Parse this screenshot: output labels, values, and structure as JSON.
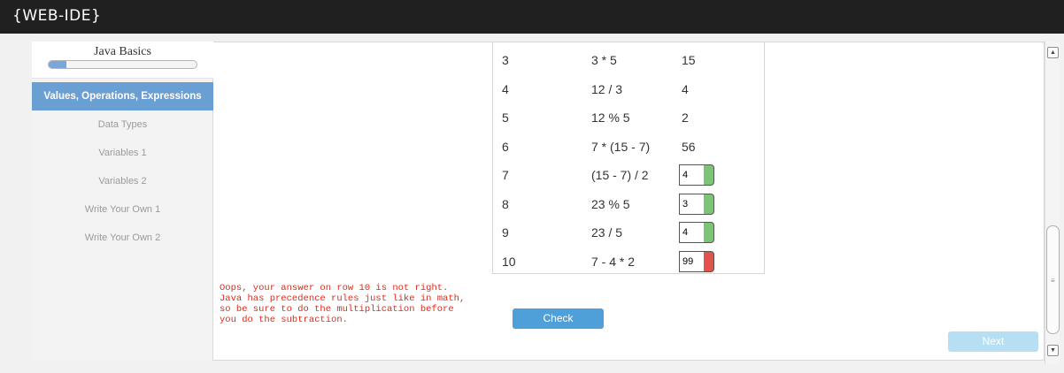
{
  "app": {
    "logo": "{WEB-IDE}"
  },
  "sidebar": {
    "title": "Java Basics",
    "progress": 0.12,
    "items": [
      {
        "label": "Values, Operations, Expressions",
        "active": true
      },
      {
        "label": "Data Types",
        "active": false
      },
      {
        "label": "Variables 1",
        "active": false
      },
      {
        "label": "Variables 2",
        "active": false
      },
      {
        "label": "Write Your Own 1",
        "active": false
      },
      {
        "label": "Write Your Own 2",
        "active": false
      }
    ]
  },
  "table": {
    "rows": [
      {
        "num": "3",
        "expr": "3 * 5",
        "result": "15"
      },
      {
        "num": "4",
        "expr": "12 / 3",
        "result": "4"
      },
      {
        "num": "5",
        "expr": "12 % 5",
        "result": "2"
      },
      {
        "num": "6",
        "expr": "7 * (15 - 7)",
        "result": "56"
      },
      {
        "num": "7",
        "expr": "(15 - 7) / 2",
        "answer": "4",
        "status": "correct"
      },
      {
        "num": "8",
        "expr": "23 % 5",
        "answer": "3",
        "status": "correct"
      },
      {
        "num": "9",
        "expr": "23 / 5",
        "answer": "4",
        "status": "correct"
      },
      {
        "num": "10",
        "expr": "7 - 4 * 2",
        "answer": "99",
        "status": "wrong"
      }
    ]
  },
  "feedback": "Oops, your answer on row 10 is not right.\nJava has precedence rules just like in math,\nso be sure to do the multiplication before\nyou do the subtraction.",
  "buttons": {
    "check": "Check",
    "next": "Next"
  },
  "colors": {
    "correct": "#7cc576",
    "wrong": "#e2534b",
    "accent": "#6a9fd3",
    "feedback": "#e02a1a"
  },
  "icons": {
    "scroll_up": "chevron-up-icon",
    "scroll_down": "chevron-down-icon"
  }
}
